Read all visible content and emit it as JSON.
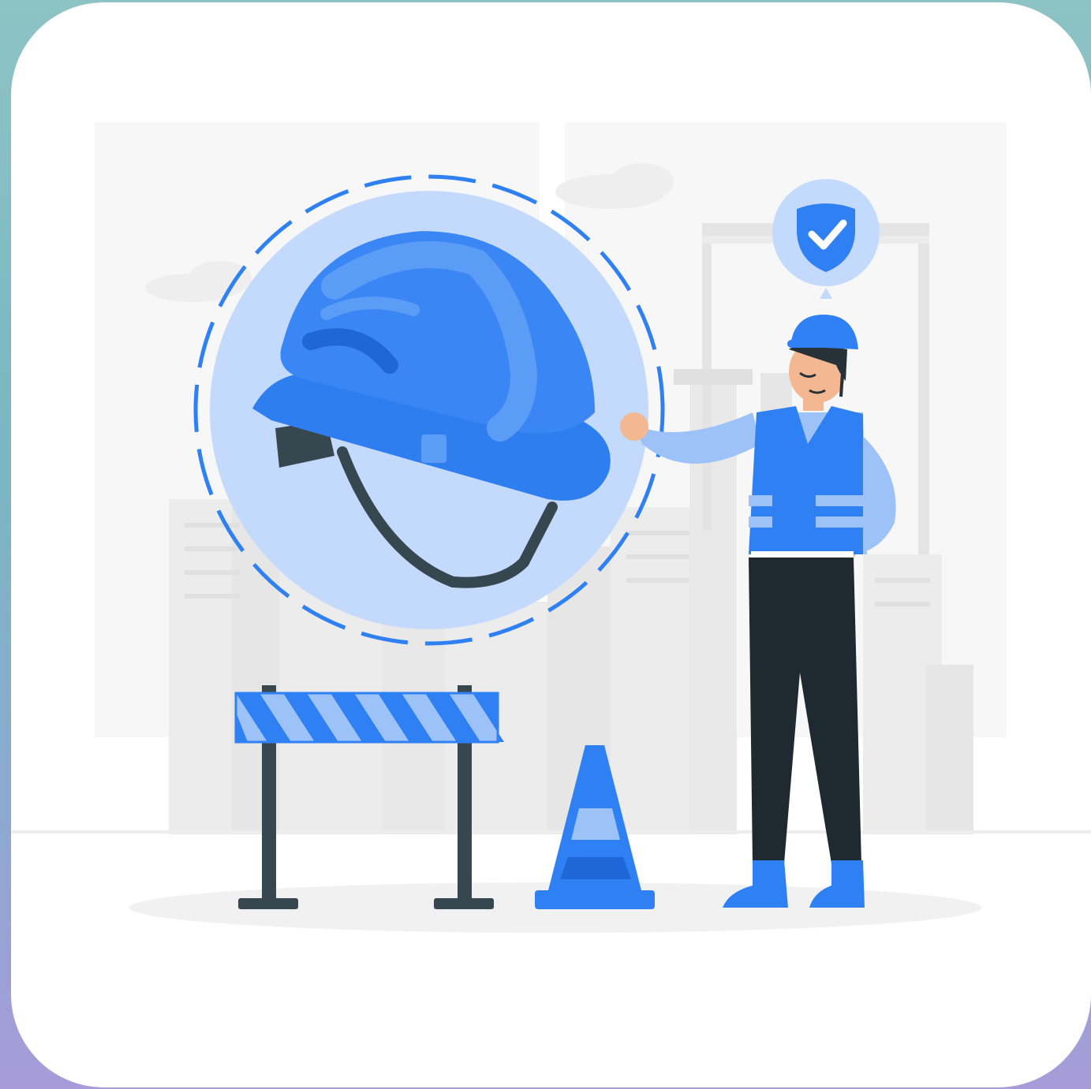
{
  "illustration": {
    "subject": "safety-helmet-worker",
    "colors": {
      "frame_top": "#8ec3c5",
      "frame_bottom": "#a79bd9",
      "card": "#ffffff",
      "accent_blue": "#2f80f2",
      "helmet_blue": "#3a86f5",
      "helmet_light": "#5b9cf7",
      "helmet_dark": "#1f67d8",
      "circle_fill": "#c4dafc",
      "dash_blue": "#2f80f2",
      "sleeve_light": "#9cc2f8",
      "pants_dark": "#1e2a30",
      "city_gray": "#ececec",
      "city_gray_dark": "#e2e2e2",
      "ground_shadow": "#f1f1f1",
      "skin": "#f3b791",
      "hair": "#263238"
    },
    "icons": [
      "shield-check-icon",
      "hard-hat-icon",
      "traffic-cone-icon",
      "road-barrier-icon"
    ]
  }
}
